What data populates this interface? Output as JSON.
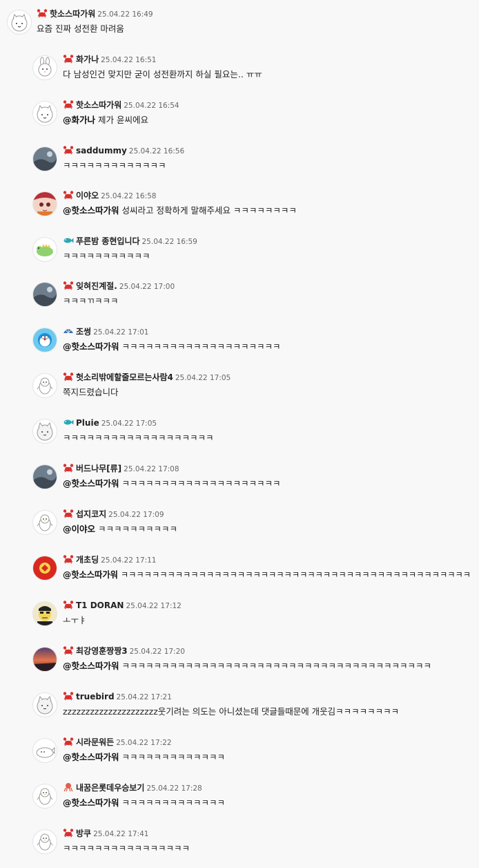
{
  "comments": [
    {
      "nick": "핫소스따가워",
      "date": "25.04.22 16:49",
      "mention": "",
      "text": "요즘 진짜 성전환 마려움",
      "badge": "crab-icon",
      "avatar": "cat-icon"
    },
    {
      "nick": "화가나",
      "date": "25.04.22 16:51",
      "mention": "",
      "text": "다 남성인건 맞지만 굳이 성전환까지 하실 필요는.. ㅠㅠ",
      "badge": "crab-icon",
      "avatar": "bunny-icon"
    },
    {
      "nick": "핫소스따가워",
      "date": "25.04.22 16:54",
      "mention": "@화가나",
      "text": "제가 윤씨에요",
      "badge": "crab-icon",
      "avatar": "cat-icon"
    },
    {
      "nick": "saddummy",
      "date": "25.04.22 16:56",
      "mention": "",
      "text": "ㅋㅋㅋㅋㅋㅋㅋㅋㅋㅋㅋㅋㅋ",
      "badge": "crab-icon",
      "avatar": "photo-icon"
    },
    {
      "nick": "이야오",
      "date": "25.04.22 16:58",
      "mention": "@핫소스따가워",
      "text": "성씨라고 정확하게 말해주세요 ㅋㅋㅋㅋㅋㅋㅋㅋ",
      "badge": "crab-icon",
      "avatar": "anime-face-icon"
    },
    {
      "nick": "푸른밤 종현입니다",
      "date": "25.04.22 16:59",
      "mention": "",
      "text": "ㅋㅋㅋㅋㅋㅋㅋㅋㅋㅋㅋ",
      "badge": "fish-icon",
      "avatar": "dinosaur-icon"
    },
    {
      "nick": "잊혀진계절.",
      "date": "25.04.22 17:00",
      "mention": "",
      "text": "ㅋㅋㅋㄲㅋㅋㅋ",
      "badge": "crab-icon",
      "avatar": "photo-icon"
    },
    {
      "nick": "조썽",
      "date": "25.04.22 17:01",
      "mention": "@핫소스따가워",
      "text": "ㅋㅋㅋㅋㅋㅋㅋㅋㅋㅋㅋㅋㅋㅋㅋㅋㅋㅋㅋㅋ",
      "badge": "shell-icon",
      "avatar": "doraemon-icon"
    },
    {
      "nick": "헛소리밖에할줄모르는사람4",
      "date": "25.04.22 17:05",
      "mention": "",
      "text": "쪽지드렸습니다",
      "badge": "crab-icon",
      "avatar": "penguin-icon"
    },
    {
      "nick": "Pluie",
      "date": "25.04.22 17:05",
      "mention": "",
      "text": "ㅋㅋㅋㅋㅋㅋㅋㅋㅋㅋㅋㅋㅋㅋㅋㅋㅋㅋㅋ",
      "badge": "fish-icon",
      "avatar": "cat-grey-icon"
    },
    {
      "nick": "버드나무[류]",
      "date": "25.04.22 17:08",
      "mention": "@핫소스따가워",
      "text": "ㅋㅋㅋㅋㅋㅋㅋㅋㅋㅋㅋㅋㅋㅋㅋㅋㅋㅋㅋㅋ",
      "badge": "crab-icon",
      "avatar": "photo-icon"
    },
    {
      "nick": "섭지코지",
      "date": "25.04.22 17:09",
      "mention": "@이야오",
      "text": "ㅋㅋㅋㅋㅋㅋㅋㅋㅋㅋ",
      "badge": "crab-icon",
      "avatar": "penguin-icon"
    },
    {
      "nick": "개초딩",
      "date": "25.04.22 17:11",
      "mention": "@핫소스따가워",
      "text": "ㅋㅋㅋㅋㅋㅋㅋㅋㅋㅋㅋㅋㅋㅋㅋㅋㅋㅋㅋㅋㅋㅋㅋㅋㅋㅋㅋㅋㅋㅋㅋㅋㅋㅋㅋㅋㅋㅋㅋㅋㅋㅋㅋㅋㅋ",
      "badge": "crab-icon",
      "avatar": "red-logo-icon"
    },
    {
      "nick": "T1 DORAN",
      "date": "25.04.22 17:12",
      "mention": "",
      "text": "ㅗㅜㅑ",
      "badge": "crab-icon",
      "avatar": "cartoon-face-icon"
    },
    {
      "nick": "최강영훈짱짱3",
      "date": "25.04.22 17:20",
      "mention": "@핫소스따가워",
      "text": "ㅋㅋㅋㅋㅋㅋㅋㅋㅋㅋㅋㅋㅋㅋㅋㅋㅋㅋㅋㅋㅋㅋㅋㅋㅋㅋㅋㅋㅋㅋㅋㅋㅋㅋㅋㅋㅋㅋㅋ",
      "badge": "crab-icon",
      "avatar": "sunset-photo-icon"
    },
    {
      "nick": "truebird",
      "date": "25.04.22 17:21",
      "mention": "",
      "text": "zzzzzzzzzzzzzzzzzzzzz웃기려는 의도는 아니셨는데 댓글들때문에 개웃김ㅋㅋㅋㅋㅋㅋㅋㅋ",
      "badge": "crab-icon",
      "avatar": "cat-grey-icon"
    },
    {
      "nick": "시라문워든",
      "date": "25.04.22 17:22",
      "mention": "@핫소스따가워",
      "text": "ㅋㅋㅋㅋㅋㅋㅋㅋㅋㅋㅋㅋㅋ",
      "badge": "crab-icon",
      "avatar": "seal-icon"
    },
    {
      "nick": "내꿈은롯데우승보기",
      "date": "25.04.22 17:28",
      "mention": "@핫소스따가워",
      "text": "ㅋㅋㅋㅋㅋㅋㅋㅋㅋㅋㅋㅋㅋ",
      "badge": "octopus-icon",
      "avatar": "penguin-icon"
    },
    {
      "nick": "방쿠",
      "date": "25.04.22 17:41",
      "mention": "",
      "text": "ㅋㅋㅋㅋㅋㅋㅋㅋㅋㅋㅋㅋㅋㅋㅋㅋ",
      "badge": "crab-icon",
      "avatar": "penguin-icon"
    }
  ],
  "colors": {
    "crab": "#d8302e",
    "fish": "#2aa7b3",
    "shell": "#3a6fb5",
    "octopus": "#e0604a"
  }
}
